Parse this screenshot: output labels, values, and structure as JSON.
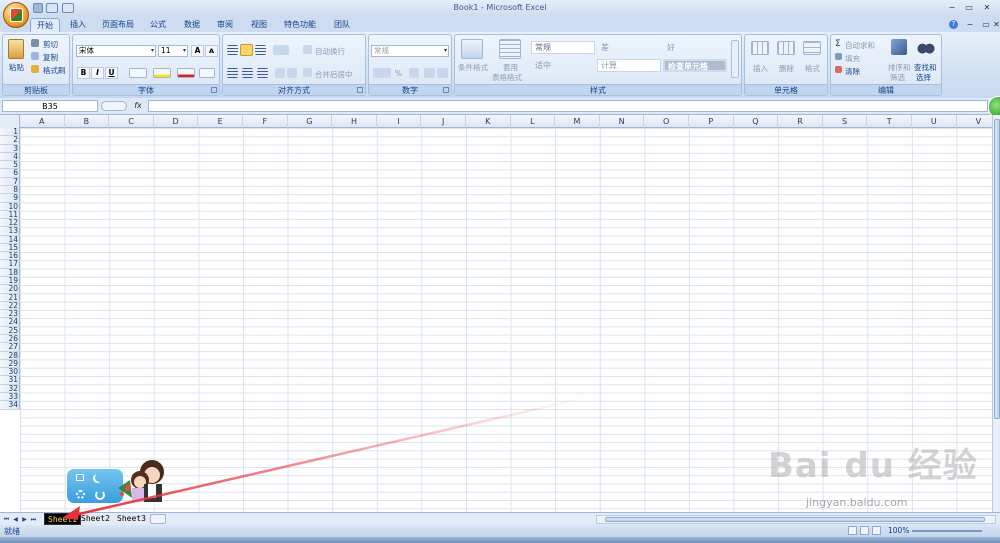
{
  "window": {
    "title": "Book1 - Microsoft Excel",
    "minimize": "−",
    "restore": "▭",
    "close": "✕",
    "help": "?"
  },
  "tabs": [
    "开始",
    "插入",
    "页面布局",
    "公式",
    "数据",
    "审阅",
    "视图",
    "特色功能",
    "团队"
  ],
  "ribbon": {
    "clipboard": {
      "label": "剪贴板",
      "paste": "粘贴",
      "cut": "剪切",
      "copy": "复制",
      "format_painter": "格式刷"
    },
    "font": {
      "label": "字体",
      "font_name": "宋体",
      "font_size": "11",
      "bold": "B",
      "italic": "I",
      "underline": "U",
      "grow": "A",
      "shrink": "A"
    },
    "alignment": {
      "label": "对齐方式",
      "wrap": "自动换行",
      "merge": "合并后居中"
    },
    "number": {
      "label": "数字",
      "format": "常规",
      "percent": "%"
    },
    "styles": {
      "label": "样式",
      "conditional": "条件格式",
      "table": "套用",
      "table2": "表格格式",
      "cells": [
        "常规",
        "差",
        "好",
        "适中",
        "计算",
        "检查单元格"
      ]
    },
    "cells_group": {
      "label": "单元格",
      "insert": "插入",
      "delete": "删除",
      "format": "格式"
    },
    "editing": {
      "label": "编辑",
      "autosum": "自动求和",
      "fill": "填充",
      "clear": "清除",
      "sort": "排序和",
      "sort2": "筛选",
      "find": "查找和",
      "find2": "选择"
    }
  },
  "formula_bar": {
    "name_box": "B35",
    "fx": "fx",
    "value": ""
  },
  "columns": [
    "A",
    "B",
    "C",
    "D",
    "E",
    "F",
    "G",
    "H",
    "I",
    "J",
    "K",
    "L",
    "M",
    "N",
    "O",
    "P",
    "Q",
    "R",
    "S",
    "T",
    "U",
    "V"
  ],
  "rows": [
    "1",
    "2",
    "3",
    "4",
    "5",
    "6",
    "7",
    "8",
    "9",
    "10",
    "11",
    "12",
    "13",
    "14",
    "15",
    "16",
    "17",
    "18",
    "19",
    "20",
    "21",
    "22",
    "23",
    "24",
    "25",
    "26",
    "27",
    "28",
    "29",
    "30",
    "31",
    "32",
    "33",
    "34"
  ],
  "sheets": [
    "Sheet1",
    "Sheet2",
    "Sheet3"
  ],
  "active_sheet": "Sheet1",
  "status": {
    "text": "就绪",
    "zoom": "100%"
  },
  "watermark": {
    "main": "Bai du 经验",
    "url": "jingyan.baidu.com"
  },
  "colors": {
    "annotation_arrow": "#e8323a",
    "ribbon_text": "#15428b"
  }
}
